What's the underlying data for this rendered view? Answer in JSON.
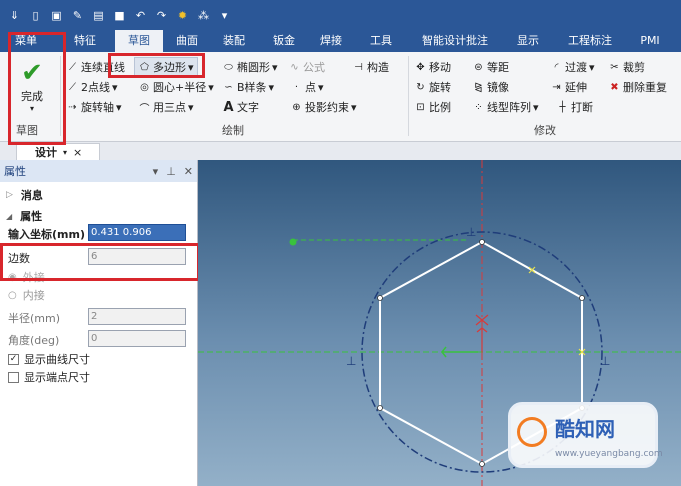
{
  "qat": {
    "icons": [
      "app-logo-icon",
      "new-file-icon",
      "open-file-icon",
      "edit-icon",
      "save-icon",
      "undo-icon",
      "redo-icon",
      "settings-icon",
      "coordinate-icon",
      "dropdown-icon"
    ]
  },
  "tabs": [
    "菜单",
    "特征",
    "草图",
    "曲面",
    "装配",
    "钣金",
    "焊接",
    "工具",
    "智能设计批注",
    "显示",
    "工程标注",
    "PMI"
  ],
  "ribbon": {
    "finish": "完成",
    "sketch_group": "草图",
    "draw_group": "绘制",
    "modify_group": "修改",
    "draw": [
      "连续直线",
      "多边形",
      "椭圆形",
      "公式",
      "构造",
      "2点线",
      "圆心+半径",
      "B样条",
      "点",
      "旋转轴",
      "用三点",
      "文字",
      "投影约束"
    ],
    "modify": [
      "移动",
      "等距",
      "过渡",
      "裁剪",
      "旋转",
      "镜像",
      "延伸",
      "删除重复",
      "比例",
      "线型阵列",
      "打断"
    ]
  },
  "doc": {
    "tab": "设计",
    "close": "×"
  },
  "panel": {
    "title": "属性",
    "message": "消息",
    "properties": "属性",
    "coord_label": "输入坐标(mm)",
    "coord_value": "0.431 0.906",
    "sides_label": "边数",
    "sides_value": "6",
    "outer": "外接",
    "inner": "内接",
    "radius_label": "半径(mm)",
    "radius_value": "2",
    "angle_label": "角度(deg)",
    "angle_value": "0",
    "show_curve": "显示曲线尺寸",
    "show_end": "显示端点尺寸"
  },
  "watermark": "酷知网",
  "watermark_url": "www.yueyangbang.com"
}
